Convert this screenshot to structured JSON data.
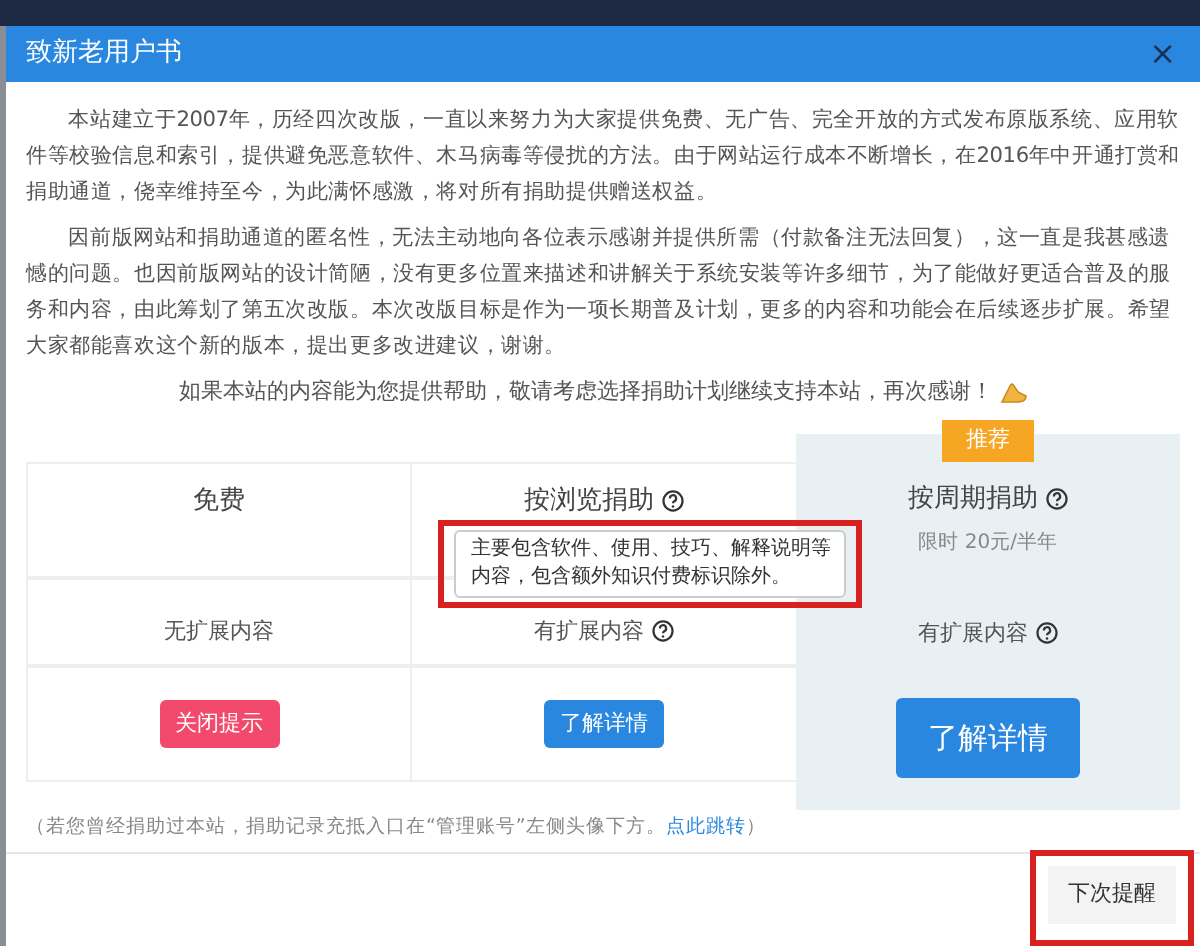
{
  "dialog": {
    "title": "致新老用户书",
    "close": "×"
  },
  "paragraphs": [
    "本站建立于2007年，历经四次改版，一直以来努力为大家提供免费、无广告、完全开放的方式发布原版系统、应用软件等校验信息和索引，提供避免恶意软件、木马病毒等侵扰的方法。由于网站运行成本不断增长，在2016年中开通打赏和捐助通道，侥幸维持至今，为此满怀感激，将对所有捐助提供赠送权益。",
    "因前版网站和捐助通道的匿名性，无法主动地向各位表示感谢并提供所需（付款备注无法回复），这一直是我甚感遗憾的问题。也因前版网站的设计简陋，没有更多位置来描述和讲解关于系统安装等许多细节，为了能做好更适合普及的服务和内容，由此筹划了第五次改版。本次改版目标是作为一项长期普及计划，更多的内容和功能会在后续逐步扩展。希望大家都能喜欢这个新的版本，提出更多改进建议，谢谢。"
  ],
  "appeal": "如果本站的内容能为您提供帮助，敬请考虑选择捐助计划继续支持本站，再次感谢！",
  "plans": [
    {
      "name": "免费",
      "name_help": false,
      "feature": "无扩展内容",
      "feature_help": false,
      "button": {
        "label": "关闭提示",
        "kind": "danger"
      },
      "recommended": false
    },
    {
      "name": "按浏览捐助",
      "name_help": true,
      "feature": "有扩展内容",
      "feature_help": true,
      "button": {
        "label": "了解详情",
        "kind": "primary"
      },
      "recommended": false
    },
    {
      "name": "按周期捐助",
      "name_help": true,
      "price": "限时 20元/半年",
      "badge": "推荐",
      "feature": "有扩展内容",
      "feature_help": true,
      "button": {
        "label": "了解详情",
        "kind": "primary"
      },
      "recommended": true
    }
  ],
  "tooltip": {
    "text": "主要包含软件、使用、技巧、解释说明等内容，包含额外知识付费标识除外。",
    "annotated": true
  },
  "footnote": {
    "text": "（若您曾经捐助过本站，捐助记录充抵入口在“管理账号”左侧头像下方。",
    "link": "点此跳转",
    "end": "）"
  },
  "footer_button": {
    "label": "下次提醒",
    "annotated": true
  }
}
